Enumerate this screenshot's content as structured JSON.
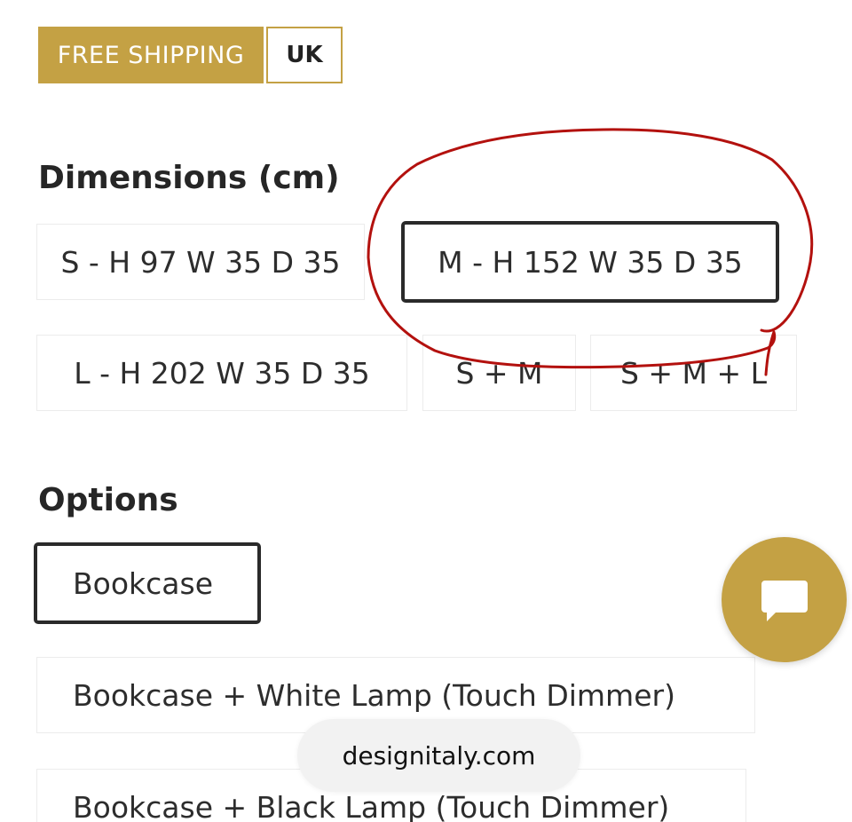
{
  "tags": {
    "shipping": "FREE SHIPPING",
    "region": "UK"
  },
  "dimensions": {
    "title": "Dimensions (cm)",
    "options": [
      {
        "label": "S - H 97 W 35 D 35",
        "selected": false
      },
      {
        "label": "M - H 152 W 35 D 35",
        "selected": true
      },
      {
        "label": "L - H 202 W 35 D 35",
        "selected": false
      },
      {
        "label": "S + M",
        "selected": false
      },
      {
        "label": "S + M + L",
        "selected": false
      }
    ]
  },
  "options": {
    "title": "Options",
    "items": [
      {
        "label": "Bookcase",
        "selected": true
      },
      {
        "label": "Bookcase + White Lamp (Touch Dimmer)",
        "selected": false
      },
      {
        "label": "Bookcase + Black Lamp (Touch Dimmer)",
        "selected": false
      }
    ]
  },
  "browser": {
    "url": "designitaly.com"
  },
  "colors": {
    "accent_gold": "#c4a144",
    "annotation_red": "#b3110e",
    "selected_border": "#2a2a2a"
  },
  "icons": {
    "chat": "chat-bubble-icon"
  }
}
